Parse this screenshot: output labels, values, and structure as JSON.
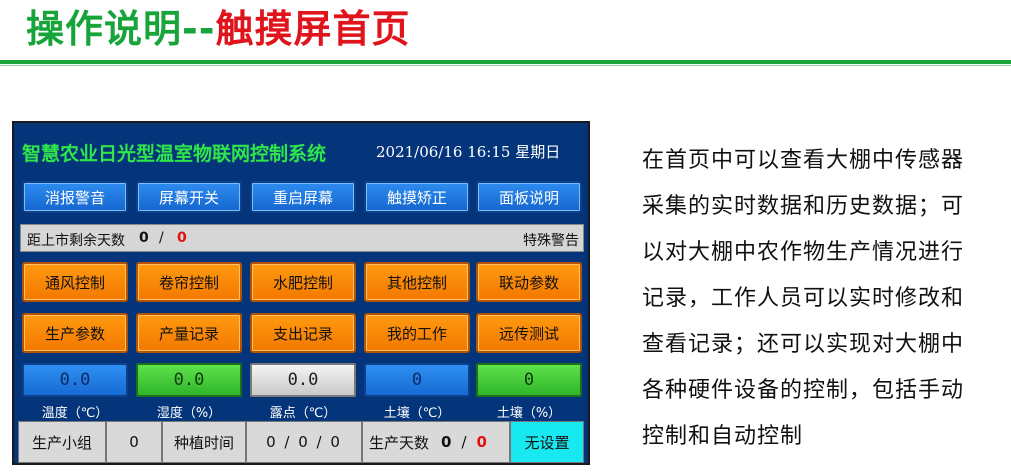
{
  "slide": {
    "title_part1": "操作说明--",
    "title_part2": "触摸屏首页",
    "title_color_green": "#17a539",
    "title_color_red": "#e0141c"
  },
  "screen": {
    "system_title": "智慧农业日光型温室物联网控制系统",
    "datetime": "2021/06/16 16:15 星期日",
    "top_buttons": [
      "消报警音",
      "屏幕开关",
      "重启屏幕",
      "触摸矫正",
      "面板说明"
    ],
    "info_bar": {
      "label": "距上市剩余天数",
      "value_a": "0",
      "separator": "/",
      "value_b": "0",
      "alarm_label": "特殊警告"
    },
    "control_row1": [
      "通风控制",
      "卷帘控制",
      "水肥控制",
      "其他控制",
      "联动参数"
    ],
    "control_row2": [
      "生产参数",
      "产量记录",
      "支出记录",
      "我的工作",
      "远传测试"
    ],
    "sensors": [
      {
        "value": "0.0",
        "label": "温度（℃）",
        "style": "blue"
      },
      {
        "value": "0.0",
        "label": "湿度（%）",
        "style": "green"
      },
      {
        "value": "0.0",
        "label": "露点（℃）",
        "style": "gray"
      },
      {
        "value": "0",
        "label": "土壤（℃）",
        "style": "blue"
      },
      {
        "value": "0",
        "label": "土壤（%）",
        "style": "green"
      }
    ],
    "bottom_bar": {
      "group_label": "生产小组",
      "group_value": "0",
      "planting_label": "种植时间",
      "planting_value": "0 / 0 / 0",
      "days_label": "生产天数",
      "days_value_a": "0",
      "days_sep": "/",
      "days_value_b": "0",
      "status": "无设置"
    },
    "colors": {
      "panel_bg": "#04357a",
      "title_green": "#2ee64a",
      "button_blue": "#1f7ae0",
      "button_orange": "#f58a00",
      "status_cyan": "#18e8ef",
      "alert_red": "#e01010"
    }
  },
  "description": {
    "lines": [
      "在首页中可以查看大棚中传感器",
      "采集的实时数据和历史数据；可",
      "以对大棚中农作物生产情况进行",
      "记录，工作人员可以实时修改和",
      "查看记录；还可以实现对大棚中",
      "各种硬件设备的控制，包括手动",
      "控制和自动控制"
    ]
  }
}
